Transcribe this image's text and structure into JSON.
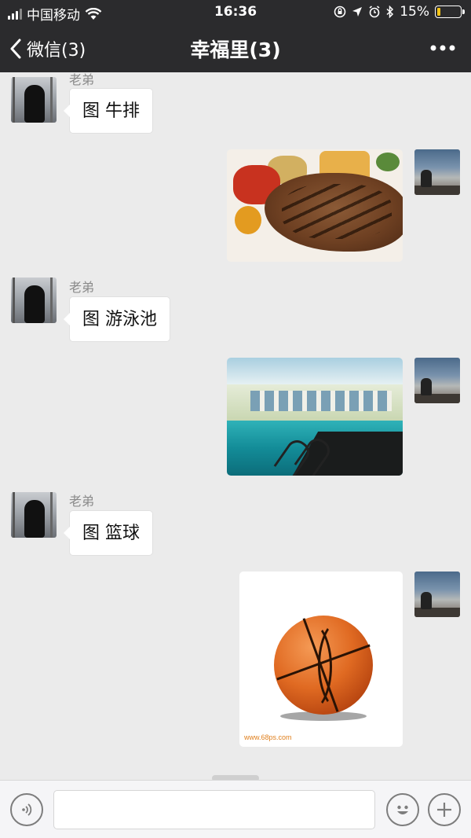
{
  "status_bar": {
    "carrier": "中国移动",
    "time": "16:36",
    "battery_percent": "15%",
    "battery_level": 0.15,
    "icons": [
      "signal-icon",
      "wifi-icon",
      "lock-rotation-icon",
      "location-icon",
      "alarm-icon",
      "bluetooth-icon",
      "battery-icon"
    ]
  },
  "nav": {
    "back_label": "微信(3)",
    "title": "幸福里(3)",
    "more_icon": "more-icon"
  },
  "messages": [
    {
      "from": "other",
      "sender": "老弟",
      "type": "text",
      "text": "图 牛排"
    },
    {
      "from": "me",
      "type": "image",
      "image": "steak-photo"
    },
    {
      "from": "other",
      "sender": "老弟",
      "type": "text",
      "text": "图 游泳池"
    },
    {
      "from": "me",
      "type": "image",
      "image": "swimming-pool-photo"
    },
    {
      "from": "other",
      "sender": "老弟",
      "type": "text",
      "text": "图 篮球"
    },
    {
      "from": "me",
      "type": "image",
      "image": "basketball-photo",
      "watermark": "www.68ps.com"
    }
  ],
  "input_bar": {
    "voice_icon": "voice-icon",
    "emoji_icon": "emoji-icon",
    "plus_icon": "plus-icon",
    "placeholder": ""
  },
  "colors": {
    "nav_bg": "#2b2b2d",
    "chat_bg": "#ebebeb",
    "battery_fill": "#f5c518"
  }
}
